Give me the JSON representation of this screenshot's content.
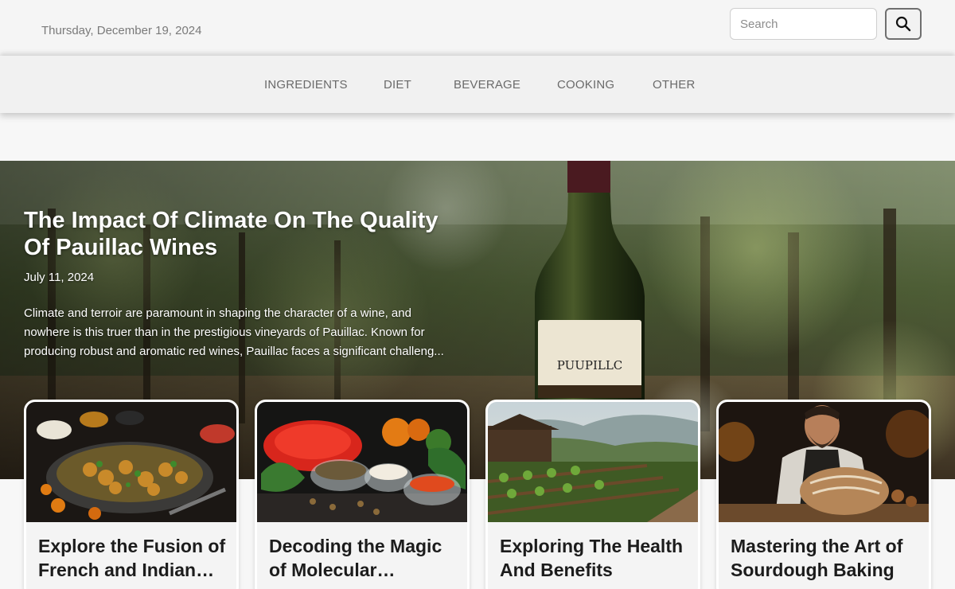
{
  "header": {
    "date": "Thursday, December 19, 2024",
    "search": {
      "placeholder": "Search",
      "value": ""
    }
  },
  "nav": {
    "items": [
      {
        "label": "INGREDIENTS"
      },
      {
        "label": "DIET"
      },
      {
        "label": "BEVERAGE"
      },
      {
        "label": "COOKING"
      },
      {
        "label": "OTHER"
      }
    ]
  },
  "hero": {
    "title": "The Impact Of Climate On The Quality Of Pauillac Wines",
    "date": "July 11, 2024",
    "excerpt": "Climate and terroir are paramount in shaping the character of a wine, and nowhere is this truer than in the prestigious vineyards of Pauillac. Known for producing robust and aromatic red wines, Pauillac faces a significant challeng...",
    "label_text": "PUUPILLC"
  },
  "cards": [
    {
      "title": "Explore the Fusion of French and Indian Cuisine"
    },
    {
      "title": "Decoding the Magic of Molecular Gastronomy"
    },
    {
      "title": "Exploring The Health And Benefits"
    },
    {
      "title": "Mastering the Art of Sourdough Baking"
    }
  ],
  "colors": {
    "page_bg": "#f7f7f7",
    "nav_bg": "#f1f1f1",
    "nav_text": "#6a6a6a",
    "hero_text": "#ffffff",
    "card_bg": "#f4f4f4"
  }
}
